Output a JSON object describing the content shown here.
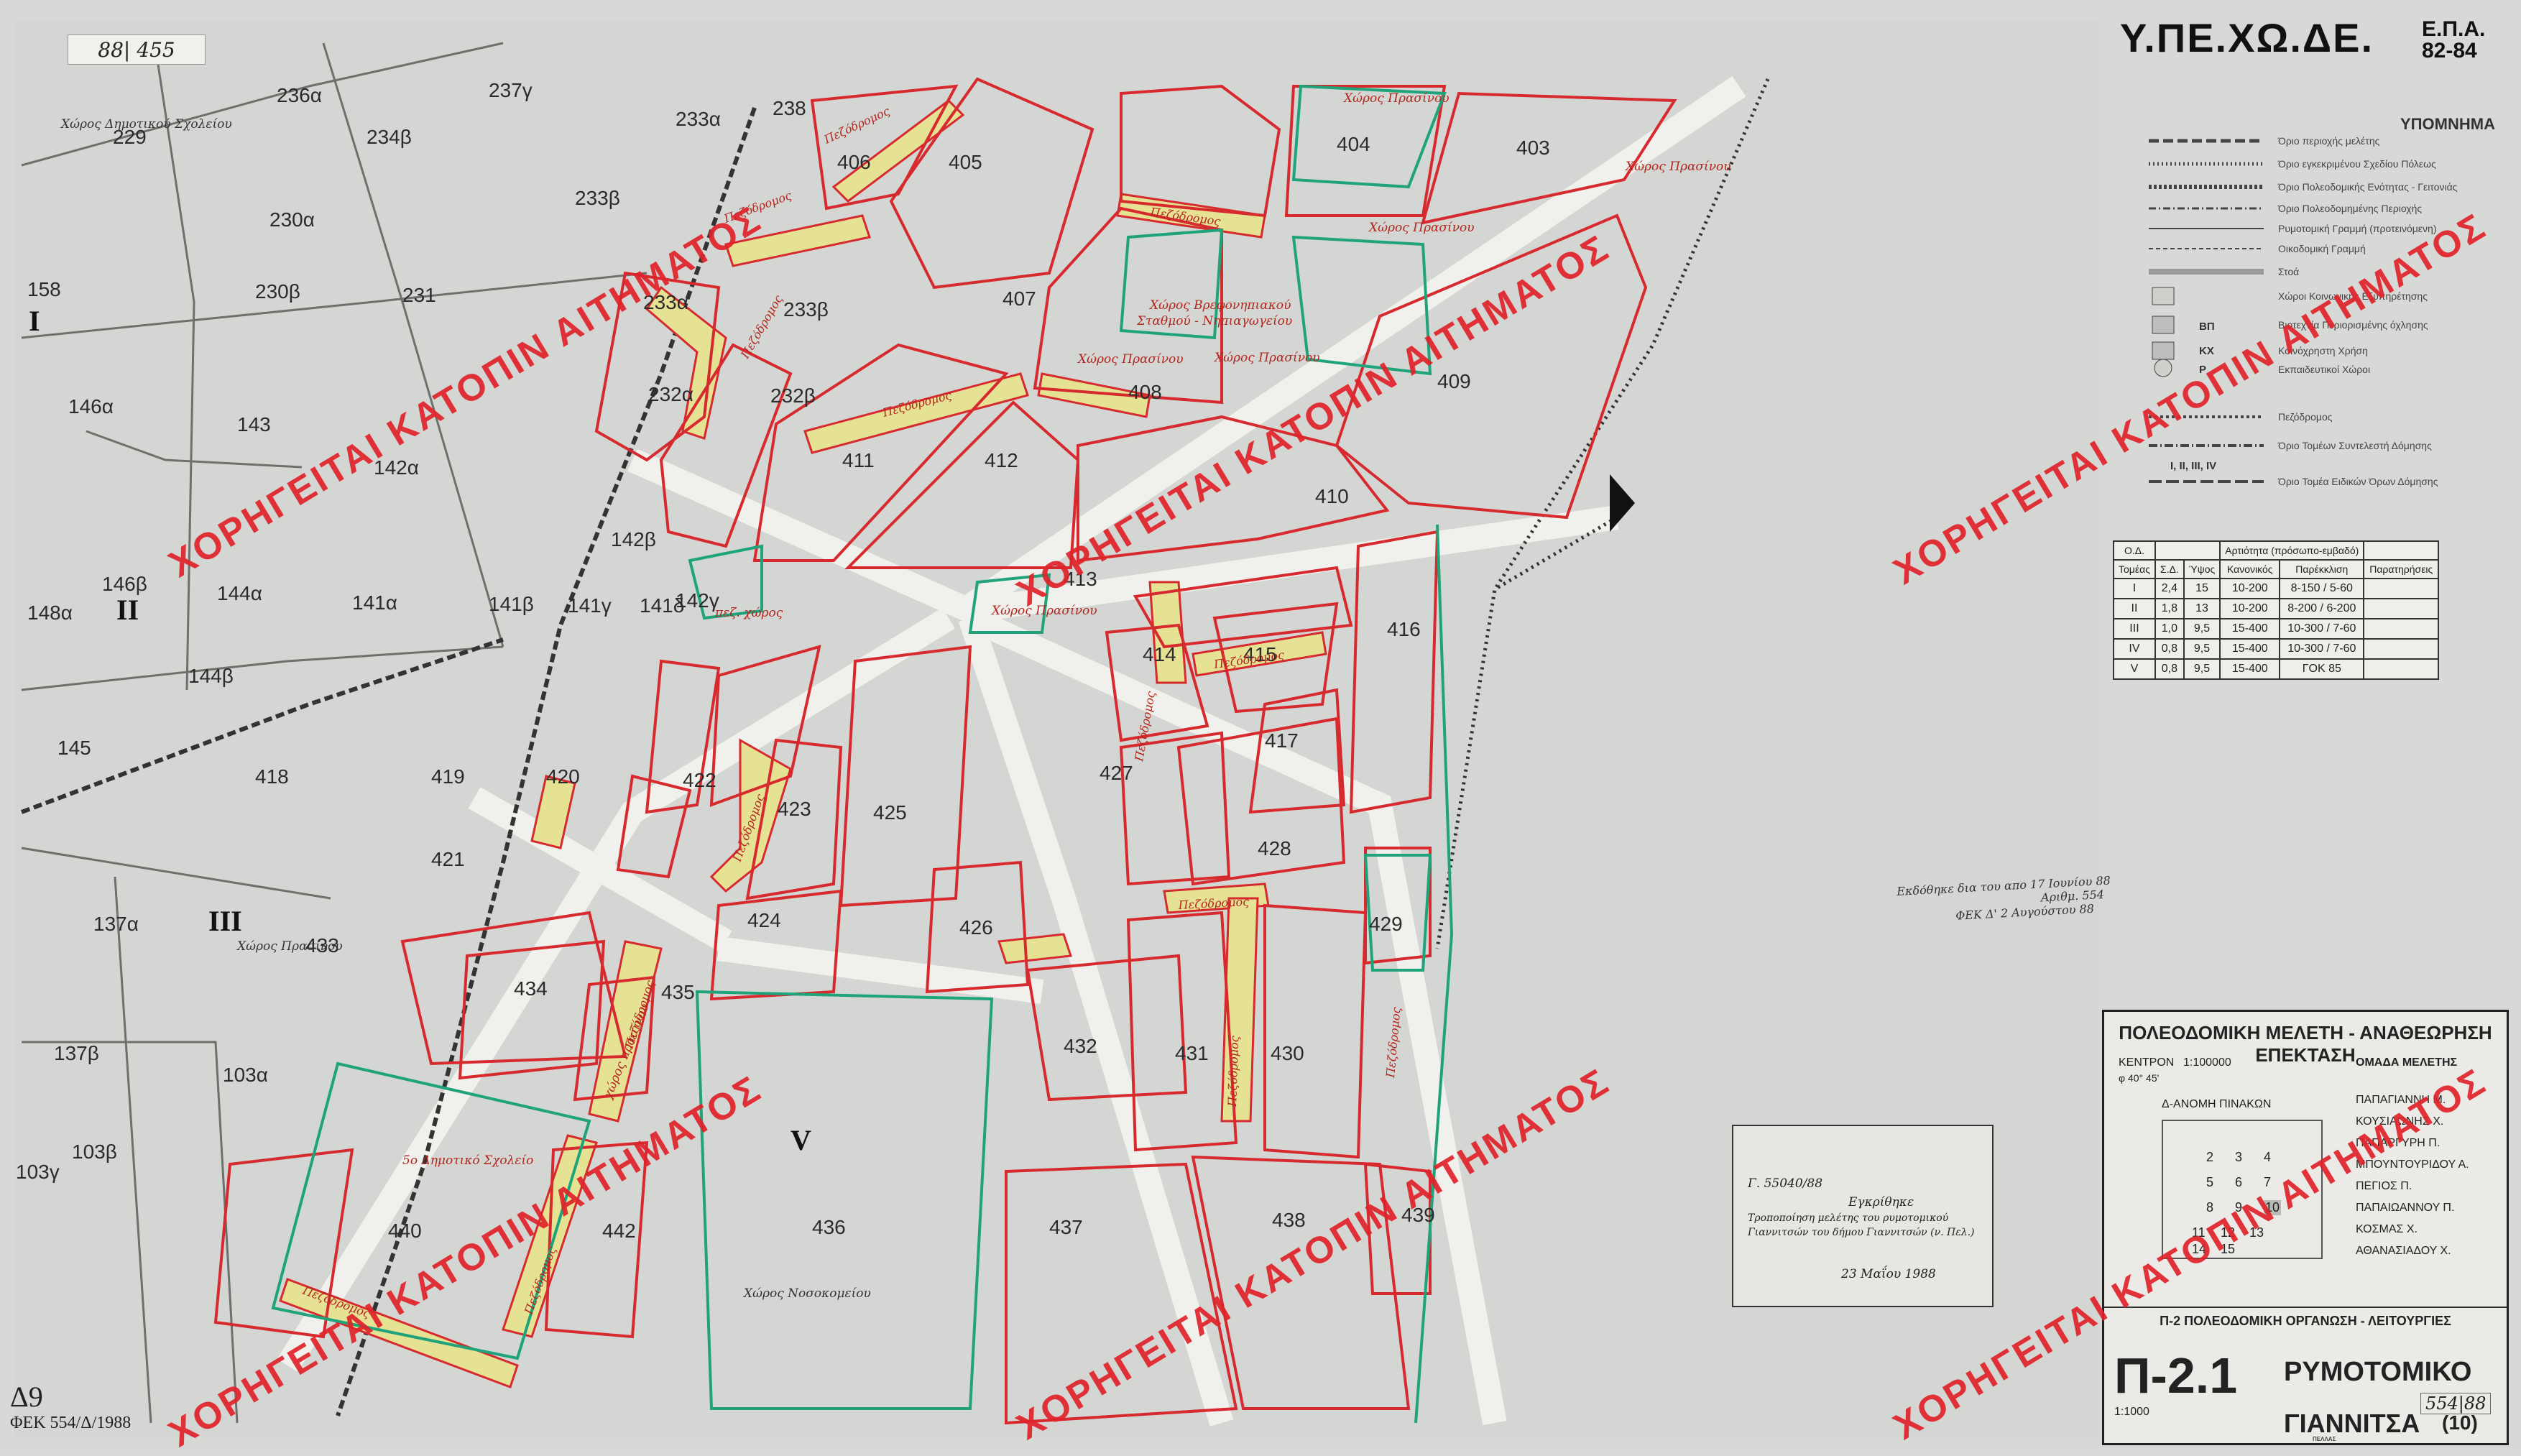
{
  "document": {
    "reference_handwritten": "88| 455",
    "agency_title": "Υ.ΠΕ.ΧΩ.ΔΕ.",
    "agency_sub_1": "Ε.Π.Α.",
    "agency_sub_2": "82-84",
    "watermark_text": "ΧΟΡΗΓΕΙΤΑΙ ΚΑΤΟΠΙΝ ΑΙΤΗΜΑΤΟΣ",
    "corner_label": "Δ9",
    "corner_gazette": "ΦΕΚ 554/Δ/1988"
  },
  "legend": {
    "title": "ΥΠΟΜΝΗΜΑ",
    "items": [
      "Όριο περιοχής μελέτης",
      "Όριο εγκεκριμένου Σχεδίου Πόλεως",
      "Όριο Πολεοδομικής Ενότητας - Γειτονιάς",
      "Όριο Πολεοδομημένης Περιοχής",
      "Ρυμοτομική Γραμμή (προτεινόμενη)",
      "Οικοδομική Γραμμή",
      "Στοά",
      "Χώροι Κοινωνικής Εξυπηρέτησης",
      "Βιοτεχνία Περιορισμένης όχλησης",
      "Κοινόχρηστη Χρήση",
      "Εκπαιδευτικοί Χώροι",
      "Πεζόδρομος",
      "Όριο Τομέων Συντελεστή Δόμησης",
      "Όριο Τομέα Ειδικών Όρων Δόμησης"
    ],
    "abbreviations": [
      "ΒΠ",
      "ΚΧ",
      "Ρ",
      "I, II, III, IV"
    ]
  },
  "zone_table": {
    "headers": [
      "Τομέας",
      "Σ.Δ.",
      "Ύψος",
      "Κανονικός",
      "Παρέκκλιση",
      "Παρατηρήσεις"
    ],
    "group_header": "Αρτιότητα (πρόσωπο-εμβαδό)",
    "corner_header": "Ο.Δ.",
    "rows": [
      [
        "I",
        "2,4",
        "15",
        "10-200",
        "8-150 / 5-60",
        ""
      ],
      [
        "II",
        "1,8",
        "13",
        "10-200",
        "8-200 / 6-200",
        ""
      ],
      [
        "III",
        "1,0",
        "9,5",
        "15-400",
        "10-300 / 7-60",
        ""
      ],
      [
        "IV",
        "0,8",
        "9,5",
        "15-400",
        "10-300 / 7-60",
        ""
      ],
      [
        "V",
        "0,8",
        "9,5",
        "15-400",
        "ΓΟΚ 85",
        ""
      ]
    ]
  },
  "gazette_stamp": {
    "line_1": "Εκδόθηκε δια του απο 17 Ιουνίου 88",
    "line_2": "Αριθμ. 554",
    "line_3": "ΦΕΚ Δ' 2 Αυγούστου 88"
  },
  "office_stamp": {
    "line_1": "Γ. 55040/88",
    "line_2": "Εγκρίθηκε",
    "line_3": "Τροποποίηση μελέτης του ρυμοτομικού",
    "line_4": "Γιαννιτσών του δήμου Γιαννιτσών (ν. Πελ.)",
    "date": "23 Μαΐου 1988"
  },
  "title_block": {
    "study": "ΠΟΛΕΟΔΟΜΙΚΗ ΜΕΛΕΤΗ - ΑΝΑΘΕΩΡΗΣΗ ΕΠΕΚΤΑΣΗ",
    "centre": "ΚΕΝΤΡΟΝ",
    "scale_small": "1:100000",
    "coords": "φ 40° 45'",
    "team_heading": "ΟΜΑΔΑ ΜΕΛΕΤΗΣ",
    "team": [
      "ΠΑΠΑΓΙΑΝΝΗ Μ.",
      "ΚΟΥΣΙΑΩΝΗΣ Χ.",
      "ΠΑΠΑΡΓΥΡΗ Π.",
      "ΜΠΟΥΝΤΟΥΡΙΔΟΥ Α.",
      "ΠΕΓΙΟΣ Π.",
      "ΠΑΠΑΙΩΑΝΝΟΥ Π.",
      "ΚΟΣΜΑΣ Χ.",
      "ΑΘΑΝΑΣΙΑΔΟΥ Χ."
    ],
    "sheet_index_heading": "Δ-ΑΝΟΜΗ ΠΙΝΑΚΩΝ",
    "sheet_numbers": [
      "2",
      "3",
      "4",
      "5",
      "6",
      "7",
      "8",
      "9",
      "10",
      "11",
      "12",
      "13",
      "14",
      "15"
    ],
    "section": "Π-2  ΠΟΛΕΟΔΟΜΙΚΗ ΟΡΓΑΝΩΣΗ - ΛΕΙΤΟΥΡΓΙΕΣ",
    "map_code": "Π-2.1",
    "map_title": "ΡΥΜΟΤΟΜΙΚΟ",
    "town": "ΓΙΑΝΝΙΤΣΑ",
    "sheet": "(10)",
    "scale": "1:1000",
    "gazette_hand": "554|88",
    "bottom": "ΠΕΛΛΑΣ"
  },
  "map": {
    "blocks": [
      {
        "id": "236α"
      },
      {
        "id": "237γ"
      },
      {
        "id": "229"
      },
      {
        "id": "233α"
      },
      {
        "id": "234β"
      },
      {
        "id": "230α"
      },
      {
        "id": "233β"
      },
      {
        "id": "230β"
      },
      {
        "id": "231"
      },
      {
        "id": "238"
      },
      {
        "id": "406"
      },
      {
        "id": "405"
      },
      {
        "id": "404"
      },
      {
        "id": "403"
      },
      {
        "id": "407"
      },
      {
        "id": "409"
      },
      {
        "id": "408"
      },
      {
        "id": "411"
      },
      {
        "id": "412"
      },
      {
        "id": "410"
      },
      {
        "id": "232α"
      },
      {
        "id": "232β"
      },
      {
        "id": "146α"
      },
      {
        "id": "143"
      },
      {
        "id": "142α"
      },
      {
        "id": "142β"
      },
      {
        "id": "142γ"
      },
      {
        "id": "146β"
      },
      {
        "id": "144α"
      },
      {
        "id": "141α"
      },
      {
        "id": "141β"
      },
      {
        "id": "141γ"
      },
      {
        "id": "141δ"
      },
      {
        "id": "148α"
      },
      {
        "id": "144β"
      },
      {
        "id": "413"
      },
      {
        "id": "414"
      },
      {
        "id": "415"
      },
      {
        "id": "416"
      },
      {
        "id": "417"
      },
      {
        "id": "145"
      },
      {
        "id": "418"
      },
      {
        "id": "419"
      },
      {
        "id": "420"
      },
      {
        "id": "421"
      },
      {
        "id": "422"
      },
      {
        "id": "423"
      },
      {
        "id": "425"
      },
      {
        "id": "427"
      },
      {
        "id": "428"
      },
      {
        "id": "137α"
      },
      {
        "id": "433"
      },
      {
        "id": "424"
      },
      {
        "id": "426"
      },
      {
        "id": "429"
      },
      {
        "id": "434"
      },
      {
        "id": "435"
      },
      {
        "id": "432"
      },
      {
        "id": "431"
      },
      {
        "id": "430"
      },
      {
        "id": "137β"
      },
      {
        "id": "103α"
      },
      {
        "id": "103β"
      },
      {
        "id": "103γ"
      },
      {
        "id": "436"
      },
      {
        "id": "437"
      },
      {
        "id": "438"
      },
      {
        "id": "439"
      },
      {
        "id": "440"
      },
      {
        "id": "442"
      },
      {
        "id": "158"
      }
    ],
    "zones": [
      "I",
      "II",
      "III",
      "V"
    ],
    "place_labels": [
      "Χώρος Πρασίνου",
      "Χώρος Πρασίνου",
      "Χώρος Πρασίνου",
      "Χώρος Βρεφονηπιακού Σταθμού - Νηπιαγωγείου",
      "Χώρος Πρασίνου",
      "Χώρος Πρασίνου",
      "Χώρος Δημοτικού Σχολείου",
      "Χώρος Πρασίνου",
      "Χώρος Νοσοκομείου",
      "Χώρος Πρασίνου",
      "5ο Δημοτικό Σχολείο",
      "χώρος πρασίνου",
      "πεζ. χώρος"
    ],
    "road_label": "Πεζόδρομος"
  },
  "colors": {
    "paper": "#d9dbd8",
    "block_red": "#d72a2f",
    "green_line": "#1fa37a",
    "pedestrian_yellow": "#e6e294",
    "watermark": "#e0232a"
  }
}
